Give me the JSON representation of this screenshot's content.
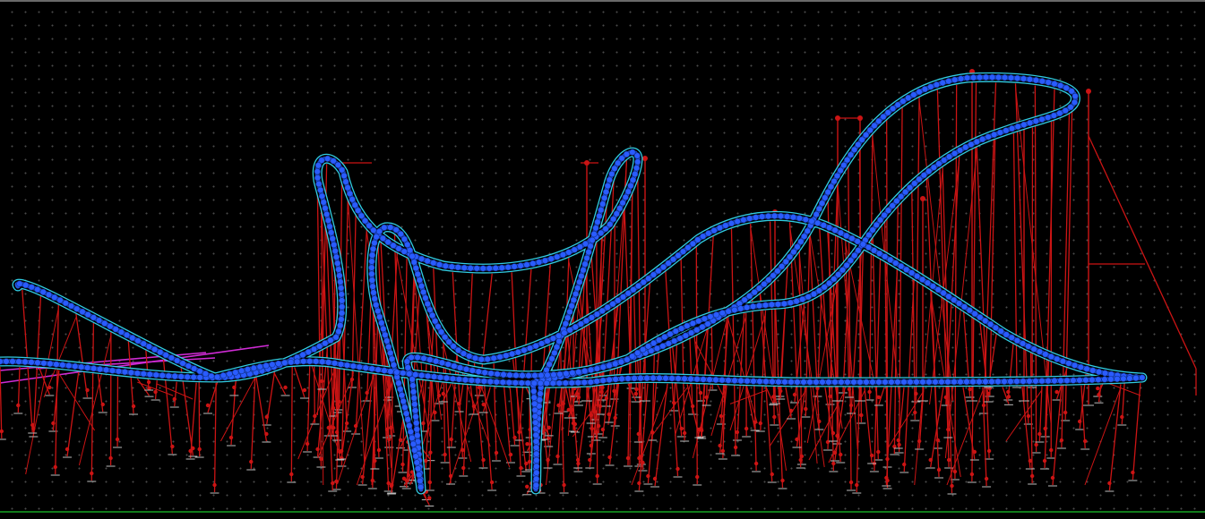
{
  "view": {
    "background": "#000000",
    "grid_dot_color": "#4a4a4a",
    "track_color": "#2255dd",
    "rail_color": "#33d7ee",
    "support_color": "#cc1414",
    "guide_color": "#d02bd6",
    "ground_color": "#0f7a1a",
    "icons": [
      "track-icon",
      "support-icon"
    ]
  }
}
